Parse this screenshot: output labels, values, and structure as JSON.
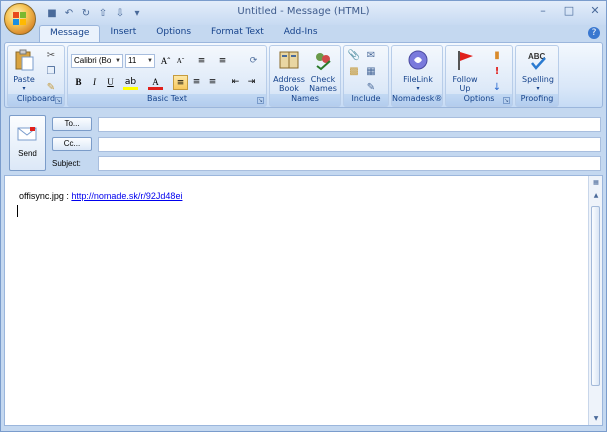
{
  "window": {
    "title": "Untitled - Message (HTML)"
  },
  "tabs": [
    {
      "label": "Message"
    },
    {
      "label": "Insert"
    },
    {
      "label": "Options"
    },
    {
      "label": "Format Text"
    },
    {
      "label": "Add-Ins"
    }
  ],
  "ribbon": {
    "clipboard": {
      "label": "Clipboard",
      "paste": "Paste"
    },
    "basic_text": {
      "label": "Basic Text",
      "font_name": "Calibri (Bo",
      "font_size": "11"
    },
    "names": {
      "label": "Names",
      "address_book": "Address Book",
      "check_names": "Check Names"
    },
    "include": {
      "label": "Include"
    },
    "nomadesk": {
      "label": "Nomadesk®",
      "filelink": "FileLink"
    },
    "options": {
      "label": "Options",
      "follow_up": "Follow Up"
    },
    "proofing": {
      "label": "Proofing",
      "spelling": "Spelling"
    }
  },
  "header": {
    "send": "Send",
    "to_button": "To...",
    "cc_button": "Cc...",
    "subject_label": "Subject:"
  },
  "body": {
    "prefix": "offisync.jpg : ",
    "link": "http://nomade.sk/r/92Jd48ei"
  },
  "colors": {
    "frame": "#c4d8f0",
    "accent": "#15428b",
    "highlight": "#f7c95f"
  }
}
